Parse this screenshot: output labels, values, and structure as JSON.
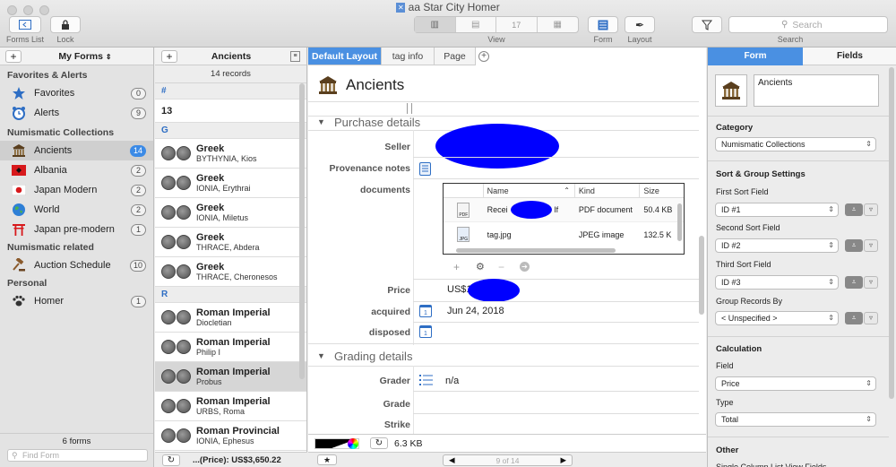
{
  "window": {
    "title": "aa Star City Homer"
  },
  "toolbar": {
    "forms_list": "Forms List",
    "lock": "Lock",
    "view": "View",
    "form": "Form",
    "layout": "Layout",
    "search_label": "Search",
    "search_placeholder": "Search"
  },
  "sidebar": {
    "header": "My Forms",
    "sections": [
      {
        "title": "Favorites & Alerts",
        "items": [
          {
            "label": "Favorites",
            "count": "0",
            "icon": "star-icon"
          },
          {
            "label": "Alerts",
            "count": "9",
            "icon": "alarm-clock-icon"
          }
        ]
      },
      {
        "title": "Numismatic Collections",
        "items": [
          {
            "label": "Ancients",
            "count": "14",
            "icon": "temple-icon",
            "selected": true
          },
          {
            "label": "Albania",
            "count": "2",
            "icon": "albania-flag-icon"
          },
          {
            "label": "Japan Modern",
            "count": "2",
            "icon": "japan-flag-icon"
          },
          {
            "label": "World",
            "count": "2",
            "icon": "globe-icon"
          },
          {
            "label": "Japan pre-modern",
            "count": "1",
            "icon": "torii-gate-icon"
          }
        ]
      },
      {
        "title": "Numismatic related",
        "items": [
          {
            "label": "Auction Schedule",
            "count": "10",
            "icon": "gavel-icon"
          }
        ]
      },
      {
        "title": "Personal",
        "items": [
          {
            "label": "Homer",
            "count": "1",
            "icon": "paw-icon"
          }
        ]
      }
    ],
    "footer_count": "6 forms",
    "find_placeholder": "Find Form"
  },
  "records": {
    "form_name": "Ancients",
    "count": "14 records",
    "groups": [
      {
        "header": "#",
        "items": [
          {
            "title": "13",
            "sub": "",
            "coins": false
          }
        ]
      },
      {
        "header": "G",
        "items": [
          {
            "title": "Greek",
            "sub": "BYTHYNIA, Kios",
            "coins": true
          },
          {
            "title": "Greek",
            "sub": "IONIA, Erythrai",
            "coins": true
          },
          {
            "title": "Greek",
            "sub": "IONIA, Miletus",
            "coins": true
          },
          {
            "title": "Greek",
            "sub": "THRACE, Abdera",
            "coins": true
          },
          {
            "title": "Greek",
            "sub": "THRACE, Cheronesos",
            "coins": true
          }
        ]
      },
      {
        "header": "R",
        "items": [
          {
            "title": "Roman Imperial",
            "sub": "Diocletian",
            "coins": true
          },
          {
            "title": "Roman Imperial",
            "sub": "Philip I",
            "coins": true
          },
          {
            "title": "Roman Imperial",
            "sub": "Probus",
            "coins": true,
            "selected": true
          },
          {
            "title": "Roman Imperial",
            "sub": "URBS, Roma",
            "coins": true
          },
          {
            "title": "Roman Provincial",
            "sub": "IONIA, Ephesus",
            "coins": true
          }
        ]
      }
    ],
    "footer_sum": "...(Price): US$3,650.22"
  },
  "main": {
    "tabs": [
      "Default Layout",
      "tag info",
      "Page"
    ],
    "record_title": "Ancients",
    "purchase_section": "Purchase details",
    "fields": {
      "seller": "Seller",
      "provenance": "Provenance notes",
      "documents": "documents",
      "price": "Price",
      "price_value": "US$1",
      "acquired": "acquired",
      "acquired_value": "Jun 24, 2018",
      "disposed": "disposed"
    },
    "doc_table": {
      "headers": [
        "Name",
        "Kind",
        "Size"
      ],
      "rows": [
        {
          "name": "Recei",
          "name_end": "lf",
          "kind": "PDF document",
          "size": "50.4 KB",
          "icon_label": "PDF"
        },
        {
          "name": "tag.jpg",
          "kind": "JPEG image",
          "size": "132.5 K",
          "icon_label": "JPG"
        }
      ]
    },
    "grading_section": "Grading details",
    "grading": {
      "grader": "Grader",
      "grader_value": "n/a",
      "grade": "Grade",
      "strike": "Strike"
    },
    "status_size": "6.3 KB",
    "pager": "9 of 14"
  },
  "right": {
    "tabs": [
      "Form",
      "Fields"
    ],
    "form_name_value": "Ancients",
    "category_header": "Category",
    "category_value": "Numismatic Collections",
    "sort_header": "Sort & Group Settings",
    "first_sort": "First Sort Field",
    "first_sort_value": "ID #1",
    "second_sort": "Second Sort Field",
    "second_sort_value": "ID #2",
    "third_sort": "Third Sort Field",
    "third_sort_value": "ID #3",
    "group_by": "Group Records By",
    "group_by_value": "< Unspecified >",
    "calc_header": "Calculation",
    "field_label": "Field",
    "field_value": "Price",
    "type_label": "Type",
    "type_value": "Total",
    "other_header": "Other",
    "other_item": "Single Column List View Fields"
  },
  "colors": {
    "accent": "#3b8ae6",
    "redaction": "#0000ff"
  }
}
